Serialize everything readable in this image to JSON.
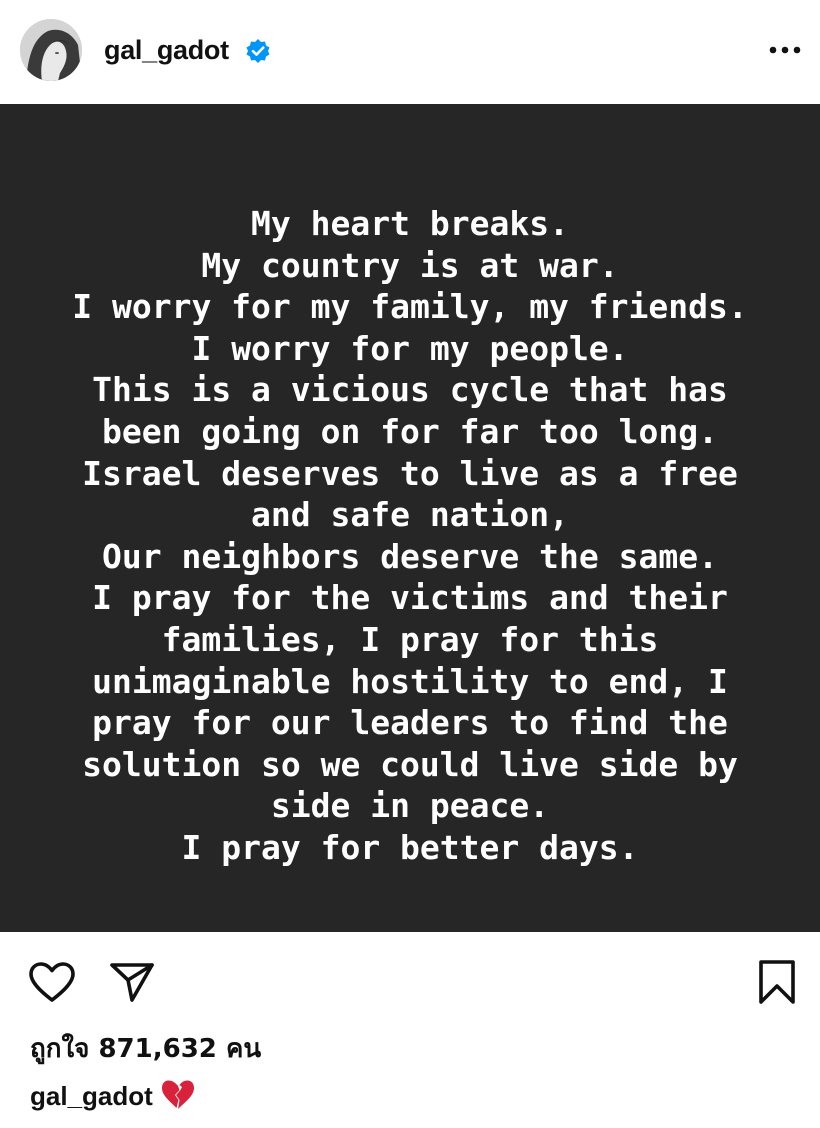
{
  "header": {
    "username": "gal_gadot",
    "verified_icon": "verified-badge-icon",
    "more_icon": "more-options-icon"
  },
  "post": {
    "background_color": "#262626",
    "text_color": "#ffffff",
    "lines": [
      "My heart breaks.",
      "My country is at war.",
      "I worry for my family, my friends.",
      "I worry for my people.",
      "This is a vicious cycle that has",
      "been going on for far too long.",
      "Israel deserves to live as a free",
      "and safe nation,",
      "Our neighbors deserve the same.",
      "I pray for the victims and their",
      "families, I pray for this",
      "unimaginable hostility to end, I",
      "pray for our leaders to find the",
      "solution so we could live side by",
      "side in peace.",
      "I pray for better days."
    ]
  },
  "actions": {
    "like_icon": "heart-icon",
    "share_icon": "paper-plane-icon",
    "save_icon": "bookmark-icon"
  },
  "likes": {
    "text": "ถูกใจ 871,632 คน"
  },
  "caption": {
    "username": "gal_gadot",
    "emoji_icon": "broken-heart-icon"
  }
}
